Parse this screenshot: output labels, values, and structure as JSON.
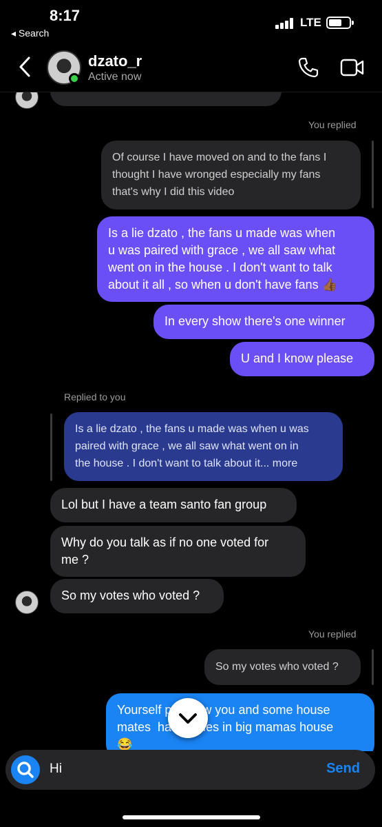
{
  "status_bar": {
    "time": "8:17",
    "back_app": "◂ Search",
    "network": "LTE"
  },
  "header": {
    "contact_name": "dzato_r",
    "contact_status": "Active now"
  },
  "messages": {
    "m1_meta": "You replied",
    "m1_quoted": [
      "Of course I have moved on and to the fans I",
      "thought I have wronged especially my fans",
      "that's why I did this video"
    ],
    "m2": [
      "Is a lie dzato , the fans u made was when",
      "u was paired with grace , we all saw what",
      "went on in the house . I don't want to talk",
      "about it all , so when u don't have fans 👍🏾"
    ],
    "m3": "In every show there's one winner",
    "m4": "U and I know please",
    "m5_meta": "Replied to you",
    "m5_quoted": [
      "Is a lie dzato , the fans u made was when u was",
      "paired with grace , we all saw what went on in",
      "the house . I don't want to talk about it... more"
    ],
    "m6": "Lol but I have a team santo fan group",
    "m7": [
      "Why do you talk as if no one voted for",
      "me ?"
    ],
    "m8": "So my votes who voted ?",
    "m9_meta": "You replied",
    "m9_quoted": "So my votes who voted ?",
    "m10": [
      "Yourself p     now you and some house",
      "mates  ha      ones in big mamas house",
      "😂"
    ]
  },
  "composer": {
    "input_value": "Hi",
    "send_label": "Send"
  },
  "colors": {
    "purple_bubble": "#6b4ff6",
    "blue_bubble": "#1a84f4",
    "incoming_bubble": "#262628",
    "online": "#3ad04a"
  }
}
